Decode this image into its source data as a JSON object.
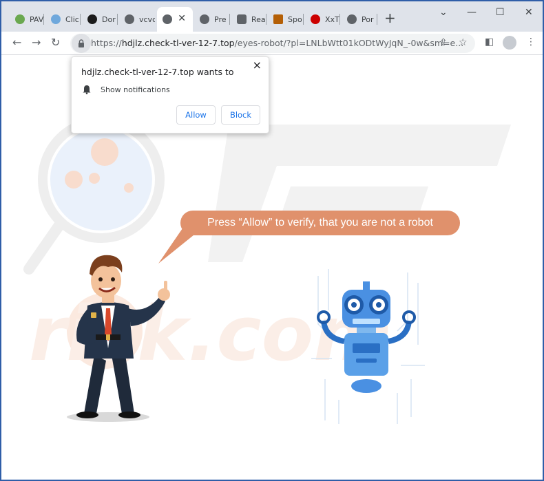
{
  "tabs": [
    {
      "title": "PAV",
      "icon": "pav-favicon",
      "color": "#6aa84f"
    },
    {
      "title": "Clic",
      "icon": "network-favicon",
      "color": "#6fa8dc"
    },
    {
      "title": "Dor",
      "icon": "eye-favicon",
      "color": "#1c1c1c"
    },
    {
      "title": "vcvc",
      "icon": "globe-icon",
      "color": "#5f6368"
    },
    {
      "title": "",
      "icon": "globe-icon",
      "color": "#5f6368",
      "active": true
    },
    {
      "title": "Pre",
      "icon": "globe-icon",
      "color": "#5f6368"
    },
    {
      "title": "Rea",
      "icon": "reader-favicon",
      "color": "#5f6368"
    },
    {
      "title": "Spo",
      "icon": "spo-favicon",
      "color": "#b45f06"
    },
    {
      "title": "XxT",
      "icon": "heart-favicon",
      "color": "#cc0000"
    },
    {
      "title": "Por",
      "icon": "globe-icon",
      "color": "#5f6368"
    }
  ],
  "url": {
    "scheme": "https://",
    "domain": "hdjlz.check-tl-ver-12-7.top",
    "path": "/eyes-robot/?pl=LNLbWtt01kODtWyJqN_-0w&sm=e..."
  },
  "popup": {
    "title": "hdjlz.check-tl-ver-12-7.top wants to",
    "permission": "Show notifications",
    "allow": "Allow",
    "block": "Block"
  },
  "page": {
    "bubble_text": "Press “Allow” to verify, that you are not a robot"
  },
  "colors": {
    "bubble": "#e0916c",
    "accent": "#1a73e8",
    "robot": "#4a90e2"
  }
}
